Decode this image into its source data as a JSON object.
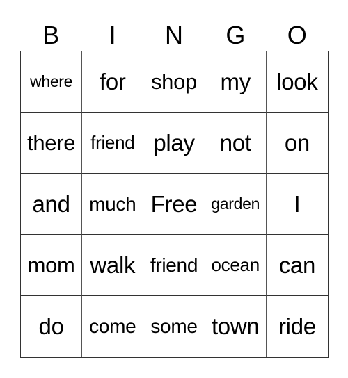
{
  "header": {
    "letters": [
      "B",
      "I",
      "N",
      "G",
      "O"
    ]
  },
  "card": {
    "rows": [
      [
        "where",
        "for",
        "shop",
        "my",
        "look"
      ],
      [
        "there",
        "friend",
        "play",
        "not",
        "on"
      ],
      [
        "and",
        "much",
        "Free",
        "garden",
        "I"
      ],
      [
        "mom",
        "walk",
        "friend",
        "ocean",
        "can"
      ],
      [
        "do",
        "come",
        "some",
        "town",
        "ride"
      ]
    ],
    "free_space": "Free"
  }
}
